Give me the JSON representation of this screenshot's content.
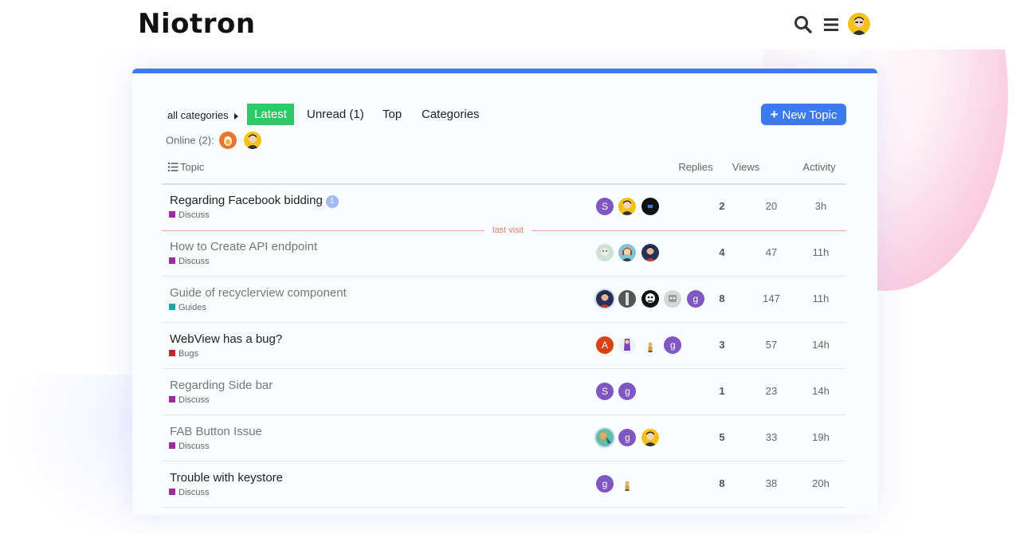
{
  "header": {
    "logo": "Niotron",
    "icons": [
      "search-icon",
      "hamburger-menu-icon"
    ]
  },
  "nav": {
    "category_dropdown": "all categories",
    "items": [
      {
        "label": "Latest",
        "active": true
      },
      {
        "label": "Unread (1)",
        "active": false
      },
      {
        "label": "Top",
        "active": false
      },
      {
        "label": "Categories",
        "active": false
      }
    ],
    "new_topic_label": "New Topic"
  },
  "online": {
    "label": "Online (2):"
  },
  "table": {
    "headers": {
      "topic": "Topic",
      "replies": "Replies",
      "views": "Views",
      "activity": "Activity"
    },
    "last_visit_label": "last visit",
    "rows": [
      {
        "title": "Regarding Facebook bidding",
        "unread": "1",
        "category": "Discuss",
        "posters": [
          "S",
          "",
          ""
        ],
        "replies": "2",
        "views": "20",
        "activity": "3h"
      },
      {
        "title": "How to Create API endpoint",
        "category": "Discuss",
        "posters": [
          "",
          "",
          ""
        ],
        "replies": "4",
        "views": "47",
        "activity": "11h"
      },
      {
        "title": "Guide of recyclerview component",
        "category": "Guides",
        "posters": [
          "",
          "",
          "",
          "",
          "g"
        ],
        "replies": "8",
        "views": "147",
        "activity": "11h"
      },
      {
        "title": "WebView has a bug?",
        "category": "Bugs",
        "posters": [
          "A",
          "",
          "",
          "g"
        ],
        "replies": "3",
        "views": "57",
        "activity": "14h"
      },
      {
        "title": "Regarding Side bar",
        "category": "Discuss",
        "posters": [
          "S",
          "g"
        ],
        "replies": "1",
        "views": "23",
        "activity": "14h"
      },
      {
        "title": "FAB Button Issue",
        "category": "Discuss",
        "posters": [
          "",
          "g",
          ""
        ],
        "replies": "5",
        "views": "33",
        "activity": "19h"
      },
      {
        "title": "Trouble with keystore",
        "category": "Discuss",
        "posters": [
          "g",
          ""
        ],
        "replies": "8",
        "views": "38",
        "activity": "20h"
      }
    ]
  },
  "colors": {
    "accent": "#3b7af0",
    "latest_active": "#2ec866",
    "category_discuss": "#9d2aa3",
    "category_guides": "#1aa7a0",
    "category_bugs": "#c8202f"
  }
}
